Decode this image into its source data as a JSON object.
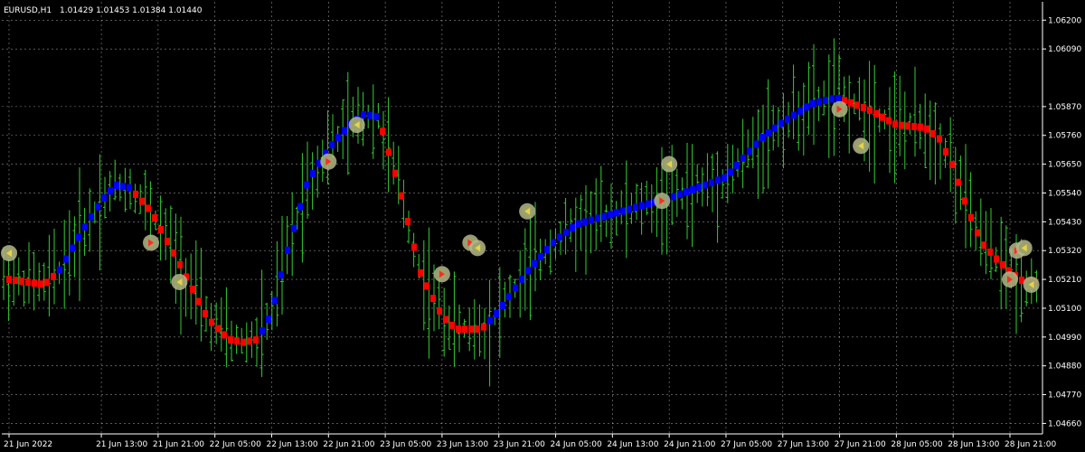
{
  "chart_data": {
    "type": "ohlc",
    "title": "EURUSD,H1",
    "ohlc_text": "1.01429 1.01453 1.01384 1.01440",
    "colors": {
      "background": "#000000",
      "bars": "#32cd32",
      "grid": "#ffffff",
      "uptrend": "#0000ff",
      "downtrend": "#ff0000",
      "axis_text": "#ffffff"
    },
    "grid": true,
    "ylim": [
      1.0462,
      1.0627
    ],
    "y_ticks": [
      1.062,
      1.0609,
      1.0587,
      1.0576,
      1.0565,
      1.0554,
      1.0543,
      1.0532,
      1.0521,
      1.051,
      1.0499,
      1.0488,
      1.0477,
      1.0466
    ],
    "y_tick_labels": [
      "1.06200",
      "1.06090",
      "1.05870",
      "1.05760",
      "1.05650",
      "1.05540",
      "1.05430",
      "1.05320",
      "1.05210",
      "1.05100",
      "1.04990",
      "1.04880",
      "1.04770",
      "1.04660"
    ],
    "x_tick_labels": [
      "21 Jun 2022",
      "21 Jun 13:00",
      "21 Jun 21:00",
      "22 Jun 05:00",
      "22 Jun 13:00",
      "22 Jun 21:00",
      "23 Jun 05:00",
      "23 Jun 13:00",
      "23 Jun 21:00",
      "24 Jun 05:00",
      "24 Jun 13:00",
      "24 Jun 21:00",
      "27 Jun 05:00",
      "27 Jun 13:00",
      "27 Jun 21:00",
      "28 Jun 05:00",
      "28 Jun 13:00",
      "28 Jun 21:00"
    ],
    "trend_line": [
      {
        "date": "21 Jun 2022",
        "price": 1.0521,
        "trend": "down"
      },
      {
        "date": "21 Jun 05:00",
        "price": 1.0519,
        "trend": "down"
      },
      {
        "date": "21 Jun 07:00",
        "price": 1.0524,
        "trend": "up"
      },
      {
        "date": "21 Jun 10:00",
        "price": 1.0538,
        "trend": "up"
      },
      {
        "date": "21 Jun 13:00",
        "price": 1.0551,
        "trend": "up"
      },
      {
        "date": "21 Jun 15:00",
        "price": 1.0557,
        "trend": "up"
      },
      {
        "date": "21 Jun 17:00",
        "price": 1.0556,
        "trend": "down"
      },
      {
        "date": "21 Jun 20:00",
        "price": 1.0547,
        "trend": "down"
      },
      {
        "date": "22 Jun 00:00",
        "price": 1.0527,
        "trend": "down"
      },
      {
        "date": "22 Jun 04:00",
        "price": 1.0506,
        "trend": "down"
      },
      {
        "date": "22 Jun 07:00",
        "price": 1.0498,
        "trend": "down"
      },
      {
        "date": "22 Jun 09:00",
        "price": 1.0497,
        "trend": "down"
      },
      {
        "date": "22 Jun 11:00",
        "price": 1.0498,
        "trend": "up"
      },
      {
        "date": "22 Jun 13:00",
        "price": 1.0508,
        "trend": "up"
      },
      {
        "date": "22 Jun 15:00",
        "price": 1.053,
        "trend": "up"
      },
      {
        "date": "22 Jun 18:00",
        "price": 1.0558,
        "trend": "up"
      },
      {
        "date": "22 Jun 21:00",
        "price": 1.0571,
        "trend": "up"
      },
      {
        "date": "23 Jun 00:00",
        "price": 1.058,
        "trend": "up"
      },
      {
        "date": "23 Jun 02:00",
        "price": 1.0584,
        "trend": "up"
      },
      {
        "date": "23 Jun 04:00",
        "price": 1.0583,
        "trend": "down"
      },
      {
        "date": "23 Jun 07:00",
        "price": 1.0556,
        "trend": "down"
      },
      {
        "date": "23 Jun 10:00",
        "price": 1.0523,
        "trend": "down"
      },
      {
        "date": "23 Jun 13:00",
        "price": 1.0507,
        "trend": "down"
      },
      {
        "date": "23 Jun 15:00",
        "price": 1.0502,
        "trend": "down"
      },
      {
        "date": "23 Jun 18:00",
        "price": 1.0502,
        "trend": "down"
      },
      {
        "date": "23 Jun 19:00",
        "price": 1.0503,
        "trend": "up"
      },
      {
        "date": "23 Jun 21:00",
        "price": 1.0509,
        "trend": "up"
      },
      {
        "date": "24 Jun 01:00",
        "price": 1.0524,
        "trend": "up"
      },
      {
        "date": "24 Jun 05:00",
        "price": 1.0536,
        "trend": "up"
      },
      {
        "date": "24 Jun 08:00",
        "price": 1.0542,
        "trend": "up"
      },
      {
        "date": "24 Jun 13:00",
        "price": 1.0546,
        "trend": "up"
      },
      {
        "date": "24 Jun 21:00",
        "price": 1.0552,
        "trend": "up"
      },
      {
        "date": "27 Jun 05:00",
        "price": 1.056,
        "trend": "up"
      },
      {
        "date": "27 Jun 10:00",
        "price": 1.0575,
        "trend": "up"
      },
      {
        "date": "27 Jun 13:00",
        "price": 1.0581,
        "trend": "up"
      },
      {
        "date": "27 Jun 17:00",
        "price": 1.0588,
        "trend": "up"
      },
      {
        "date": "27 Jun 20:00",
        "price": 1.059,
        "trend": "up"
      },
      {
        "date": "27 Jun 21:00",
        "price": 1.059,
        "trend": "down"
      },
      {
        "date": "28 Jun 01:00",
        "price": 1.0586,
        "trend": "down"
      },
      {
        "date": "28 Jun 05:00",
        "price": 1.058,
        "trend": "down"
      },
      {
        "date": "28 Jun 09:00",
        "price": 1.0579,
        "trend": "down"
      },
      {
        "date": "28 Jun 11:00",
        "price": 1.0575,
        "trend": "down"
      },
      {
        "date": "28 Jun 13:00",
        "price": 1.0564,
        "trend": "down"
      },
      {
        "date": "28 Jun 15:00",
        "price": 1.0548,
        "trend": "down"
      },
      {
        "date": "28 Jun 17:00",
        "price": 1.0535,
        "trend": "down"
      },
      {
        "date": "28 Jun 19:00",
        "price": 1.0529,
        "trend": "down"
      },
      {
        "date": "28 Jun 21:00",
        "price": 1.0524,
        "trend": "down"
      },
      {
        "date": "28 Jun 23:00",
        "price": 1.052,
        "trend": "down"
      }
    ],
    "signals": [
      {
        "date": "21 Jun 2022",
        "price": 1.0531,
        "dir": "left"
      },
      {
        "date": "21 Jun 20:00",
        "price": 1.0535,
        "dir": "right"
      },
      {
        "date": "22 Jun 00:00",
        "price": 1.052,
        "dir": "left"
      },
      {
        "date": "22 Jun 21:00",
        "price": 1.0566,
        "dir": "right"
      },
      {
        "date": "23 Jun 01:00",
        "price": 1.058,
        "dir": "left"
      },
      {
        "date": "23 Jun 13:00",
        "price": 1.0523,
        "dir": "right"
      },
      {
        "date": "23 Jun 17:00",
        "price": 1.0535,
        "dir": "right"
      },
      {
        "date": "23 Jun 18:00",
        "price": 1.0533,
        "dir": "left"
      },
      {
        "date": "24 Jun 01:00",
        "price": 1.0547,
        "dir": "left"
      },
      {
        "date": "24 Jun 20:00",
        "price": 1.0551,
        "dir": "right"
      },
      {
        "date": "24 Jun 21:00",
        "price": 1.0565,
        "dir": "left"
      },
      {
        "date": "27 Jun 21:00",
        "price": 1.0586,
        "dir": "right"
      },
      {
        "date": "28 Jun 00:00",
        "price": 1.0572,
        "dir": "left"
      },
      {
        "date": "28 Jun 21:00",
        "price": 1.0521,
        "dir": "right"
      },
      {
        "date": "28 Jun 22:00",
        "price": 1.0532,
        "dir": "right"
      },
      {
        "date": "28 Jun 23:00",
        "price": 1.0533,
        "dir": "left"
      },
      {
        "date": "29 Jun 00:00",
        "price": 1.0519,
        "dir": "left"
      }
    ]
  }
}
